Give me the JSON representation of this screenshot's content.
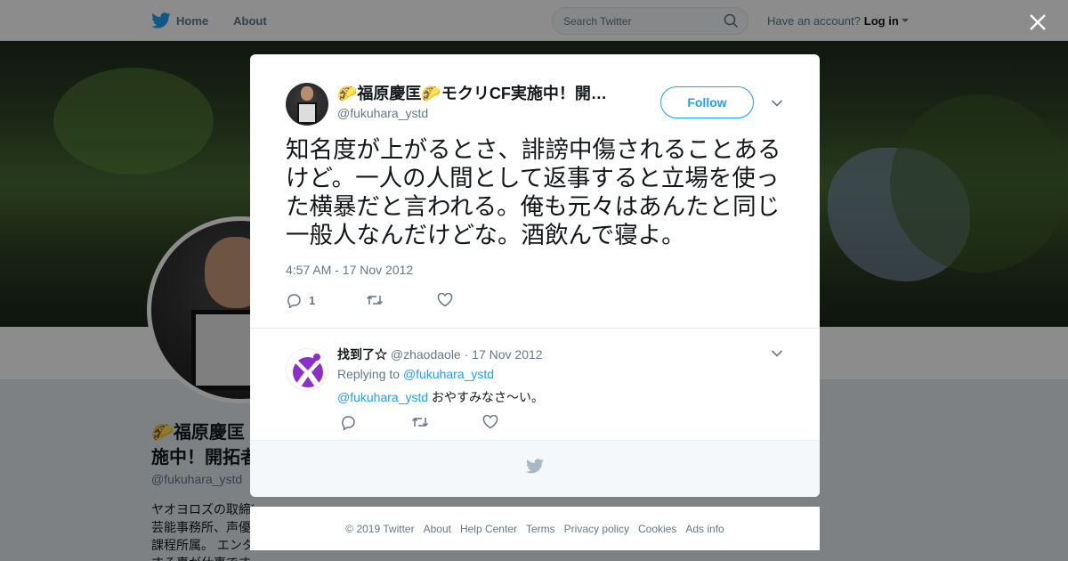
{
  "nav": {
    "home": "Home",
    "about": "About",
    "search_placeholder": "Search Twitter",
    "have_account": "Have an account?",
    "login": "Log in"
  },
  "background_profile": {
    "name_line1": "🌮福原慶匡",
    "name_line2": "施中！開拓者",
    "handle": "@fukuhara_ystd",
    "bio_lines": [
      "ヤオヨロズの取締役 アニメP・音楽P",
      "芸能事務所、声優",
      "課程所属。 エンタ",
      "する事が仕事です一緒にお仕事したい方"
    ]
  },
  "tweet": {
    "author_name": "🌮福原慶匡🌮モクリCF実施中！開拓者",
    "author_handle": "@fukuhara_ystd",
    "follow_label": "Follow",
    "text": "知名度が上がるとさ、誹謗中傷されることあるけど。一人の人間として返事すると立場を使った横暴だと言われる。俺も元々はあんたと同じ一般人なんだけどな。酒飲んで寝よ。",
    "timestamp": "4:57 AM - 17 Nov 2012",
    "reply_count": "1"
  },
  "reply": {
    "author_name": "找到了☆",
    "author_handle": "@zhaodaole",
    "date": "· 17 Nov 2012",
    "replying_to_label": "Replying to",
    "replying_to_handle": "@fukuhara_ystd",
    "mention": "@fukuhara_ystd",
    "text": "おやすみなさ～い。"
  },
  "footer": {
    "links": [
      "© 2019 Twitter",
      "About",
      "Help Center",
      "Terms",
      "Privacy policy",
      "Cookies",
      "Ads info"
    ]
  },
  "colors": {
    "brand_blue": "#1da1f2",
    "text_dark": "#14171a",
    "text_gray": "#657786"
  },
  "icons": [
    "twitter-bird-icon",
    "search-icon",
    "close-icon",
    "chevron-down-icon",
    "reply-icon",
    "retweet-icon",
    "like-icon"
  ]
}
